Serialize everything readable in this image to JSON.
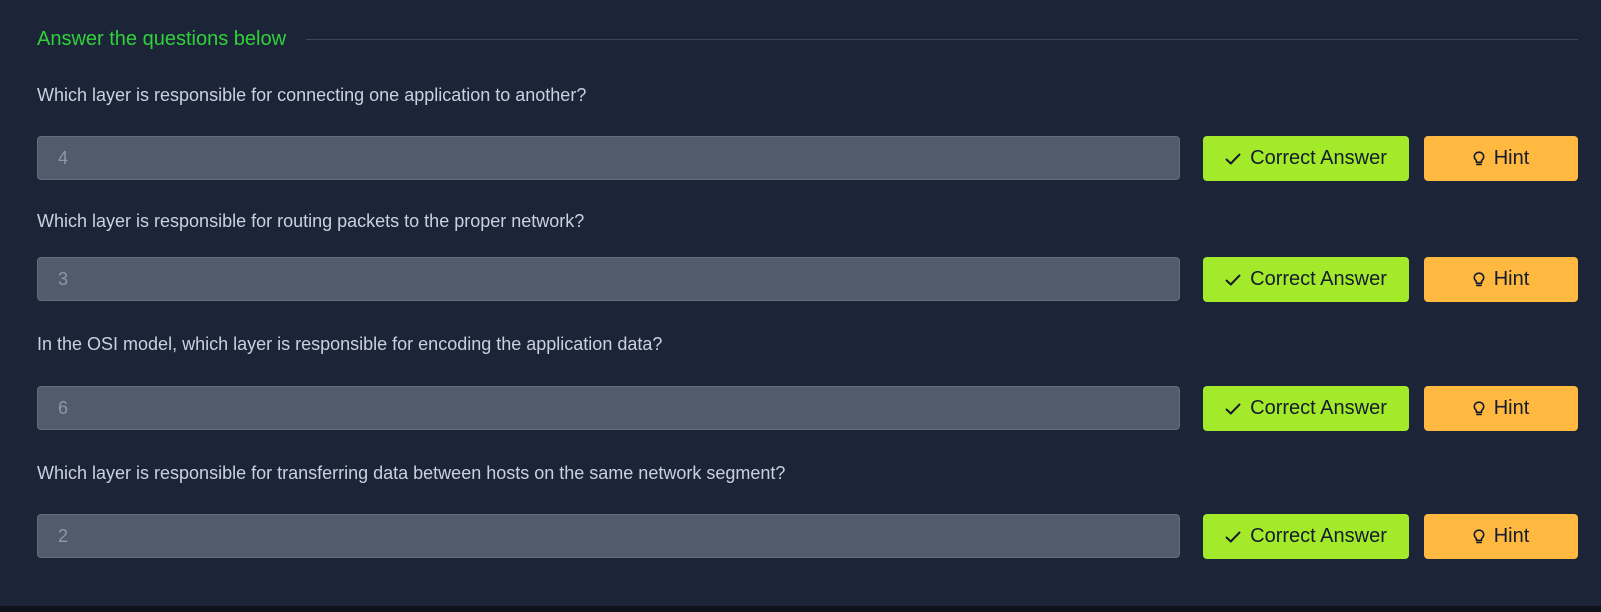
{
  "section": {
    "title": "Answer the questions below"
  },
  "questions": [
    {
      "text": "Which layer is responsible for connecting one application to another?",
      "answer": "4"
    },
    {
      "text": "Which layer is responsible for routing packets to the proper network?",
      "answer": "3"
    },
    {
      "text": "In the OSI model, which layer is responsible for encoding the application data?",
      "answer": "6"
    },
    {
      "text": "Which layer is responsible for transferring data between hosts on the same network segment?",
      "answer": "2"
    }
  ],
  "buttons": {
    "correct_label": "Correct Answer",
    "correct_icon": "check-icon",
    "hint_label": "Hint",
    "hint_icon": "lightbulb-icon"
  },
  "colors": {
    "background": "#1c2538",
    "accent_title": "#2fd13a",
    "correct_button": "#a3ea2a",
    "hint_button": "#ffb840",
    "answer_field": "#525b6b"
  }
}
